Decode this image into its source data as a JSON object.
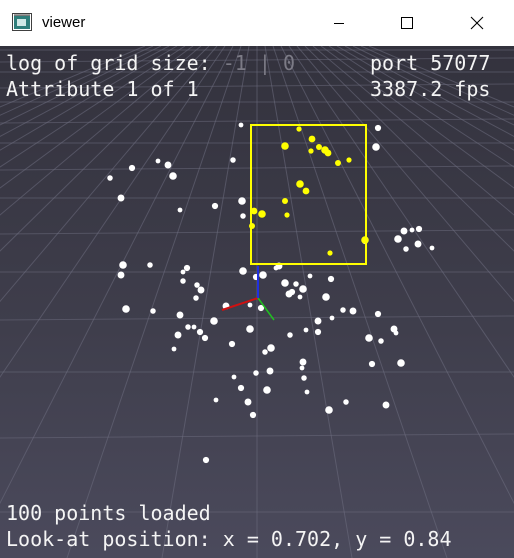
{
  "window": {
    "title": "viewer"
  },
  "hud": {
    "grid_label": "log of grid size:",
    "grid_inactive": "-1 | 0",
    "port": "port 57077",
    "attribute": "Attribute 1 of 1",
    "fps": "3387.2 fps",
    "points_loaded": "100 points loaded",
    "look_at": "Look-at position: x = 0.702, y = 0.84"
  },
  "colors": {
    "background_top": "#33323d",
    "background_bottom": "#4b4a5c",
    "grid": "#6e6d80",
    "point": "#ffffff",
    "selected_point": "#ffff00",
    "selection_box": "#ffff00",
    "axis_x": "#d01010",
    "axis_y": "#20c020",
    "axis_z": "#2030e0"
  },
  "icons": {
    "app": "viewer-window-icon",
    "minimize": "minimize-icon",
    "maximize": "maximize-icon",
    "close": "close-icon"
  }
}
